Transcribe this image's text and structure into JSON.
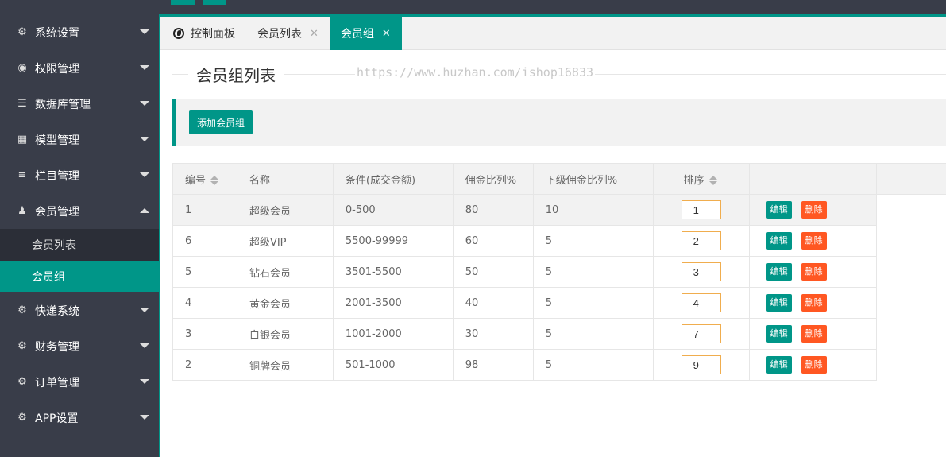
{
  "sidebar": {
    "items": [
      {
        "label": "系统设置",
        "icon": "gear-icon"
      },
      {
        "label": "权限管理",
        "icon": "globe-icon"
      },
      {
        "label": "数据库管理",
        "icon": "database-icon"
      },
      {
        "label": "模型管理",
        "icon": "grid-icon"
      },
      {
        "label": "栏目管理",
        "icon": "list-icon"
      },
      {
        "label": "会员管理",
        "icon": "user-icon"
      }
    ],
    "sub_items": [
      {
        "label": "会员列表"
      },
      {
        "label": "会员组"
      }
    ],
    "items_after": [
      {
        "label": "快递系统",
        "icon": "gear-icon"
      },
      {
        "label": "财务管理",
        "icon": "gear-icon"
      },
      {
        "label": "订单管理",
        "icon": "gear-icon"
      },
      {
        "label": "APP设置",
        "icon": "gear-icon"
      }
    ]
  },
  "tabs": [
    {
      "label": "控制面板"
    },
    {
      "label": "会员列表"
    },
    {
      "label": "会员组"
    }
  ],
  "page": {
    "title": "会员组列表",
    "watermark": "https://www.huzhan.com/ishop16833",
    "add_button": "添加会员组"
  },
  "table": {
    "headers": [
      "编号",
      "名称",
      "条件(成交金额)",
      "佣金比列%",
      "下级佣金比列%",
      "排序",
      ""
    ],
    "rows": [
      {
        "id": "1",
        "name": "超级会员",
        "cond": "0-500",
        "rate": "80",
        "sub_rate": "10",
        "order": "1"
      },
      {
        "id": "6",
        "name": "超级VIP",
        "cond": "5500-99999",
        "rate": "60",
        "sub_rate": "5",
        "order": "2"
      },
      {
        "id": "5",
        "name": "钻石会员",
        "cond": "3501-5500",
        "rate": "50",
        "sub_rate": "5",
        "order": "3"
      },
      {
        "id": "4",
        "name": "黄金会员",
        "cond": "2001-3500",
        "rate": "40",
        "sub_rate": "5",
        "order": "4"
      },
      {
        "id": "3",
        "name": "白银会员",
        "cond": "1001-2000",
        "rate": "30",
        "sub_rate": "5",
        "order": "7"
      },
      {
        "id": "2",
        "name": "铜牌会员",
        "cond": "501-1000",
        "rate": "98",
        "sub_rate": "5",
        "order": "9"
      }
    ],
    "edit_label": "编辑",
    "delete_label": "删除"
  },
  "colors": {
    "accent": "#009688",
    "danger": "#ff5722",
    "sidebar": "#393d49"
  }
}
